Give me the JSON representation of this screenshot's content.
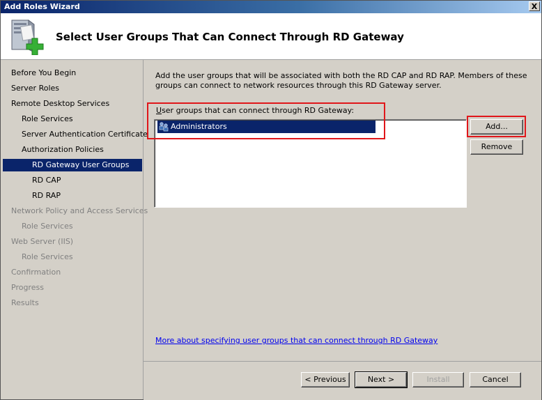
{
  "window": {
    "title": "Add Roles Wizard",
    "close_label": "X"
  },
  "header": {
    "title": "Select User Groups That Can Connect Through RD Gateway",
    "icon": "server-add-role-icon"
  },
  "sidebar": {
    "items": [
      {
        "label": "Before You Begin",
        "level": 0,
        "state": "normal"
      },
      {
        "label": "Server Roles",
        "level": 0,
        "state": "normal"
      },
      {
        "label": "Remote Desktop Services",
        "level": 0,
        "state": "normal"
      },
      {
        "label": "Role Services",
        "level": 1,
        "state": "normal"
      },
      {
        "label": "Server Authentication Certificate",
        "level": 1,
        "state": "normal"
      },
      {
        "label": "Authorization Policies",
        "level": 1,
        "state": "normal"
      },
      {
        "label": "RD Gateway User Groups",
        "level": 2,
        "state": "active"
      },
      {
        "label": "RD CAP",
        "level": 2,
        "state": "normal"
      },
      {
        "label": "RD RAP",
        "level": 2,
        "state": "normal"
      },
      {
        "label": "Network Policy and Access Services",
        "level": 0,
        "state": "dim"
      },
      {
        "label": "Role Services",
        "level": 1,
        "state": "dim"
      },
      {
        "label": "Web Server (IIS)",
        "level": 0,
        "state": "dim"
      },
      {
        "label": "Role Services",
        "level": 1,
        "state": "dim"
      },
      {
        "label": "Confirmation",
        "level": 0,
        "state": "dim"
      },
      {
        "label": "Progress",
        "level": 0,
        "state": "dim"
      },
      {
        "label": "Results",
        "level": 0,
        "state": "dim"
      }
    ]
  },
  "main": {
    "description": "Add the user groups that will be associated with both the RD CAP and RD RAP. Members of these groups can connect to network resources through this RD Gateway server.",
    "list_label_access_key": "U",
    "list_label_rest": "ser groups that can connect through RD Gateway:",
    "groups": [
      {
        "name": "Administrators",
        "icon": "user-group-icon",
        "selected": true
      }
    ],
    "add_button": "Add...",
    "remove_button": "Remove",
    "help_link": "More about specifying user groups that can connect through RD Gateway"
  },
  "footer": {
    "previous": "< Previous",
    "next": "Next >",
    "install": "Install",
    "cancel": "Cancel"
  },
  "colors": {
    "selection": "#0a246a",
    "highlight_box": "#e0161a",
    "link": "#0000ee"
  }
}
